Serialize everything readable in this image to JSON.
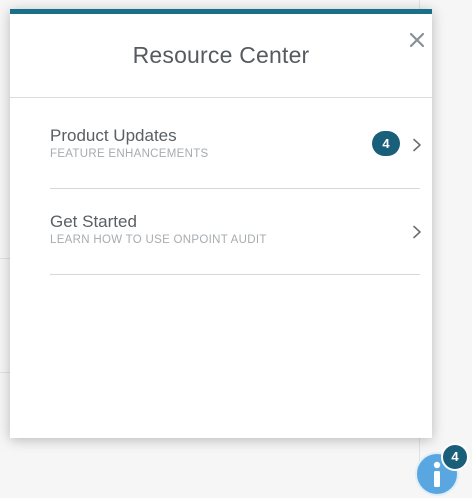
{
  "panel": {
    "title": "Resource Center",
    "accent_color": "#1a6f8a",
    "close_icon": "close-icon"
  },
  "items": [
    {
      "title": "Product Updates",
      "subtitle": "FEATURE ENHANCEMENTS",
      "badge": "4",
      "icon": "chevron-right-icon"
    },
    {
      "title": "Get Started",
      "subtitle": "LEARN HOW TO USE ONPOINT AUDIT",
      "icon": "chevron-right-icon"
    }
  ],
  "launcher": {
    "icon": "info-icon",
    "badge": "4",
    "color": "#5aa6e0",
    "badge_color": "#1a5f7a"
  }
}
